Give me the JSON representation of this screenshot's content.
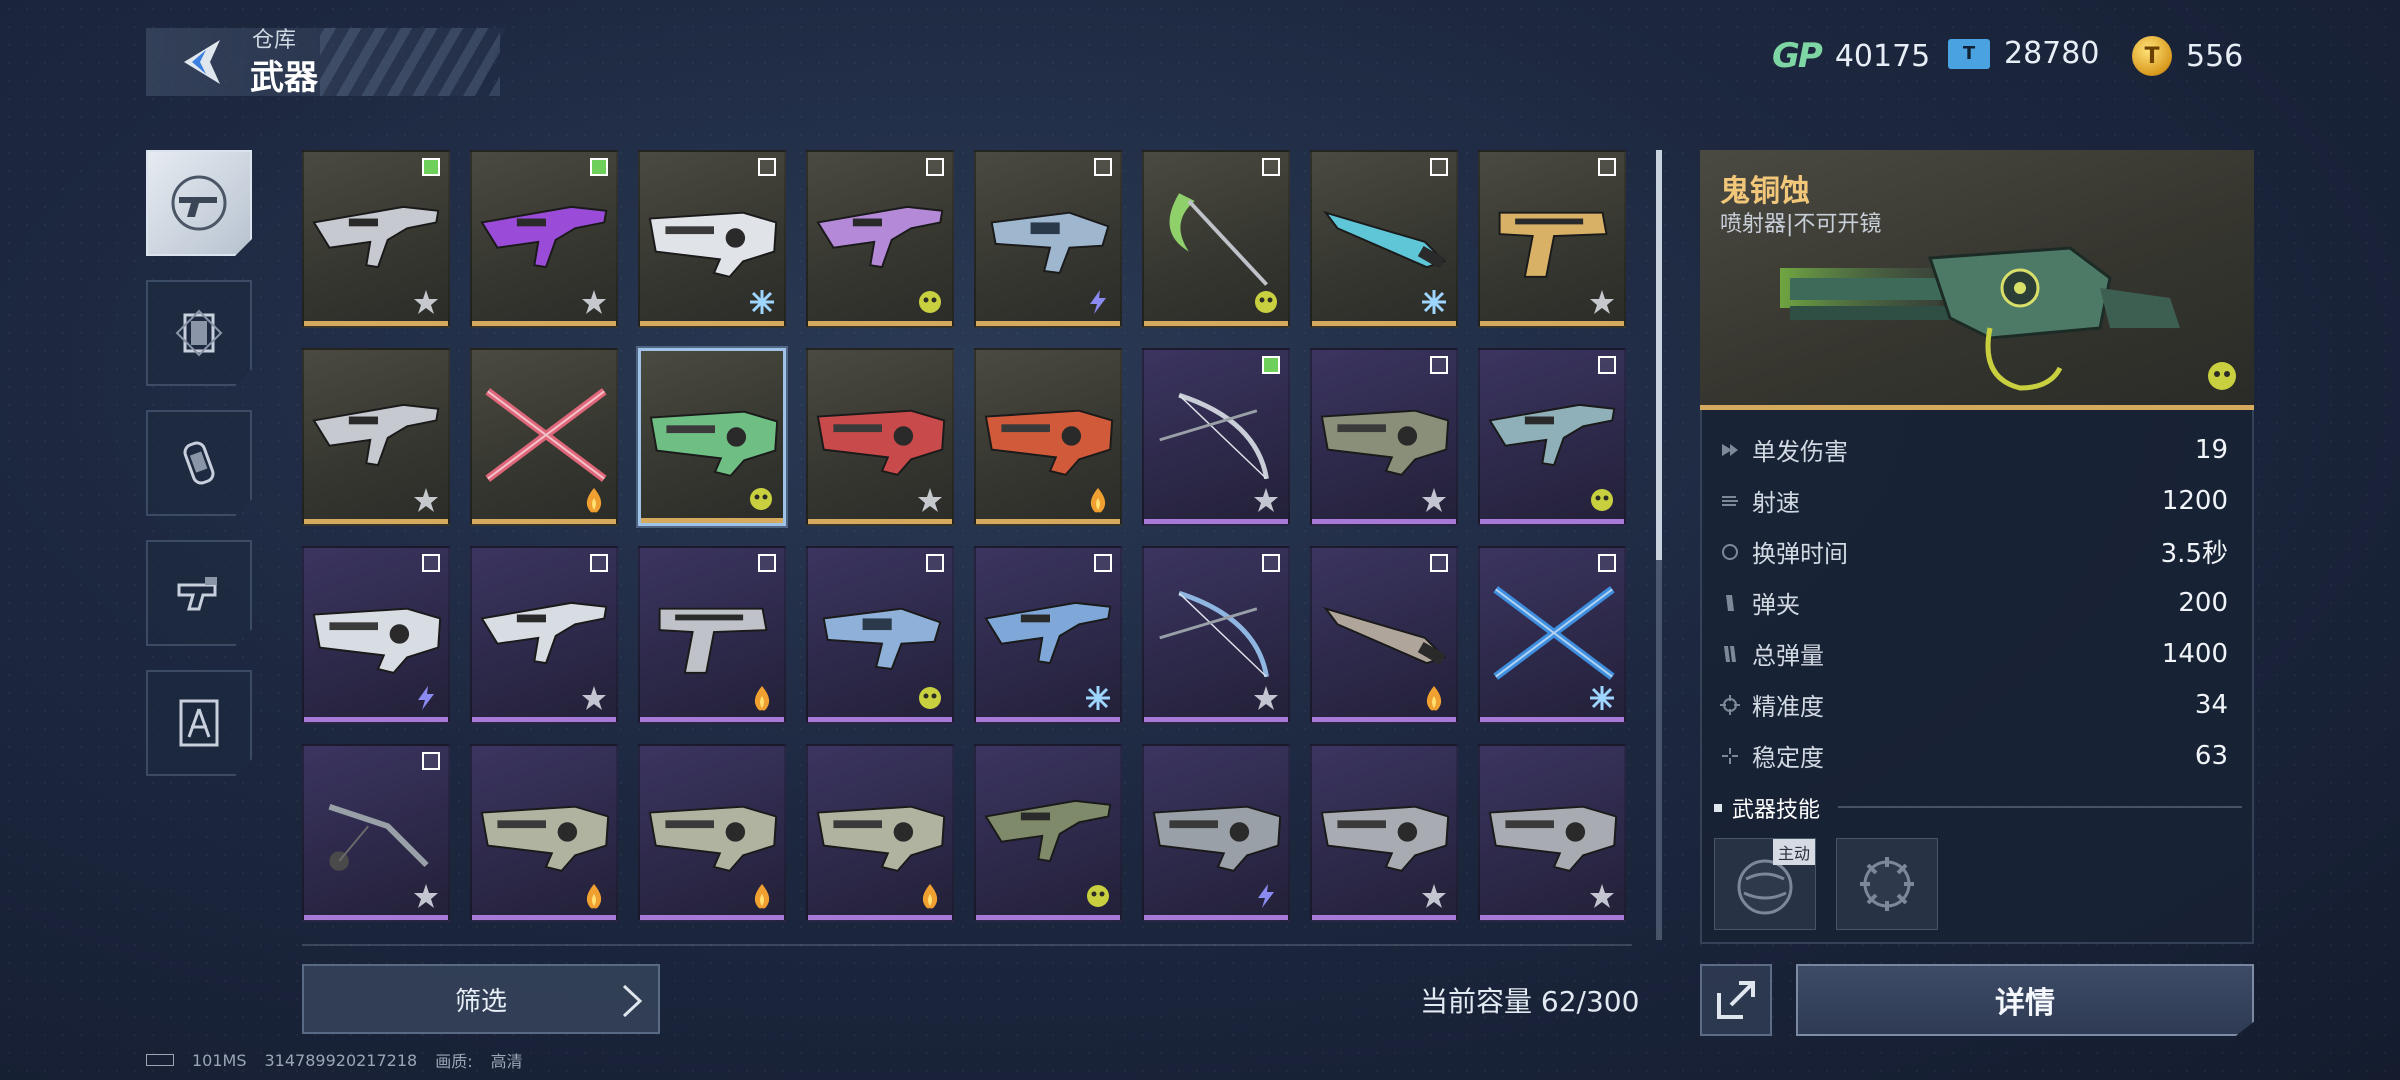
{
  "header": {
    "breadcrumb_parent": "仓库",
    "title": "武器"
  },
  "currencies": [
    {
      "icon": "gp-icon",
      "value": "40175"
    },
    {
      "icon": "ticket-icon",
      "value": "28780"
    },
    {
      "icon": "coin-icon",
      "value": "556"
    }
  ],
  "categories": [
    {
      "icon": "gun-icon",
      "active": true
    },
    {
      "icon": "armor-icon",
      "active": false
    },
    {
      "icon": "grenade-icon",
      "active": false
    },
    {
      "icon": "gadget-icon",
      "active": false
    },
    {
      "icon": "blueprint-icon",
      "active": false
    }
  ],
  "weapons": [
    {
      "rarity": "gold",
      "checked": true,
      "tag": "star",
      "shape": "rifle",
      "color": "#c6c9cf"
    },
    {
      "rarity": "gold",
      "checked": true,
      "tag": "star",
      "shape": "rifle",
      "color": "#9a4bd8"
    },
    {
      "rarity": "gold",
      "checked": false,
      "tag": "ice",
      "shape": "heavy",
      "color": "#e0e3e8"
    },
    {
      "rarity": "gold",
      "checked": false,
      "tag": "toxic",
      "shape": "rifle",
      "color": "#b48ad8"
    },
    {
      "rarity": "gold",
      "checked": false,
      "tag": "lightning",
      "shape": "blaster",
      "color": "#9fb6cf"
    },
    {
      "rarity": "gold",
      "checked": false,
      "tag": "toxic",
      "shape": "scythe",
      "color": "#8fd06b"
    },
    {
      "rarity": "gold",
      "checked": false,
      "tag": "ice",
      "shape": "blade",
      "color": "#5fc6d8"
    },
    {
      "rarity": "gold",
      "checked": false,
      "tag": "star",
      "shape": "pistol",
      "color": "#d8b066"
    },
    {
      "rarity": "gold",
      "checked": null,
      "tag": "star",
      "shape": "rifle",
      "color": "#c6c9cf"
    },
    {
      "rarity": "gold",
      "checked": null,
      "tag": "fire",
      "shape": "swords",
      "color": "#e0667a"
    },
    {
      "rarity": "gold",
      "checked": null,
      "tag": "toxic",
      "shape": "heavy",
      "color": "#6fbf85",
      "selected": true
    },
    {
      "rarity": "gold",
      "checked": null,
      "tag": "star",
      "shape": "heavy",
      "color": "#c94a4a"
    },
    {
      "rarity": "gold",
      "checked": null,
      "tag": "fire",
      "shape": "heavy",
      "color": "#d05a3a"
    },
    {
      "rarity": "purple",
      "checked": true,
      "tag": "star",
      "shape": "bow",
      "color": "#c9ced8"
    },
    {
      "rarity": "purple",
      "checked": false,
      "tag": "star",
      "shape": "heavy",
      "color": "#8a8f7a"
    },
    {
      "rarity": "purple",
      "checked": false,
      "tag": "toxic",
      "shape": "rifle",
      "color": "#8fb0b8"
    },
    {
      "rarity": "purple",
      "checked": false,
      "tag": "lightning",
      "shape": "heavy",
      "color": "#d8dde4"
    },
    {
      "rarity": "purple",
      "checked": false,
      "tag": "star",
      "shape": "rifle",
      "color": "#d8dde4"
    },
    {
      "rarity": "purple",
      "checked": false,
      "tag": "fire",
      "shape": "pistol",
      "color": "#bfc3c9"
    },
    {
      "rarity": "purple",
      "checked": false,
      "tag": "toxic",
      "shape": "blaster",
      "color": "#8fb0d8"
    },
    {
      "rarity": "purple",
      "checked": false,
      "tag": "ice",
      "shape": "rifle",
      "color": "#7fa8d8"
    },
    {
      "rarity": "purple",
      "checked": false,
      "tag": "star",
      "shape": "bow",
      "color": "#8fb6e0"
    },
    {
      "rarity": "purple",
      "checked": false,
      "tag": "fire",
      "shape": "blade",
      "color": "#b0a59a"
    },
    {
      "rarity": "purple",
      "checked": false,
      "tag": "ice",
      "shape": "swords",
      "color": "#3f8fe0"
    },
    {
      "rarity": "purple",
      "checked": false,
      "tag": "star",
      "shape": "flail",
      "color": "#9aa0a8"
    },
    {
      "rarity": "purple",
      "checked": null,
      "tag": "fire",
      "shape": "heavy",
      "color": "#b0b3a0"
    },
    {
      "rarity": "purple",
      "checked": null,
      "tag": "fire",
      "shape": "heavy",
      "color": "#b0b3a0"
    },
    {
      "rarity": "purple",
      "checked": null,
      "tag": "fire",
      "shape": "heavy",
      "color": "#b0b3a0"
    },
    {
      "rarity": "purple",
      "checked": null,
      "tag": "toxic",
      "shape": "rifle",
      "color": "#7f8a6a"
    },
    {
      "rarity": "purple",
      "checked": null,
      "tag": "lightning",
      "shape": "heavy",
      "color": "#9aa0a8"
    },
    {
      "rarity": "purple",
      "checked": null,
      "tag": "star",
      "shape": "heavy",
      "color": "#a8acb2"
    },
    {
      "rarity": "purple",
      "checked": null,
      "tag": "star",
      "shape": "heavy",
      "color": "#a8acb2"
    }
  ],
  "filter": {
    "label": "筛选"
  },
  "capacity": {
    "label": "当前容量 62/300"
  },
  "detail": {
    "name": "鬼铜蚀",
    "type": "喷射器|不可开镜",
    "stats": [
      {
        "label": "单发伤害",
        "value": "19"
      },
      {
        "label": "射速",
        "value": "1200"
      },
      {
        "label": "换弹时间",
        "value": "3.5秒"
      },
      {
        "label": "弹夹",
        "value": "200"
      },
      {
        "label": "总弹量",
        "value": "1400"
      },
      {
        "label": "精准度",
        "value": "34"
      },
      {
        "label": "稳定度",
        "value": "63"
      }
    ],
    "skills_title": "武器技能",
    "skill_badge": "主动",
    "button": "详情"
  },
  "footer": {
    "ping": "101MS",
    "uid": "314789920217218",
    "quality_label": "画质:",
    "quality_value": "高清"
  },
  "colors": {
    "gold_bar": "#d6aa5e",
    "purple_bar": "#a77ad8",
    "name_gold": "#f2c77a",
    "check_on": "#6fcf5b"
  }
}
